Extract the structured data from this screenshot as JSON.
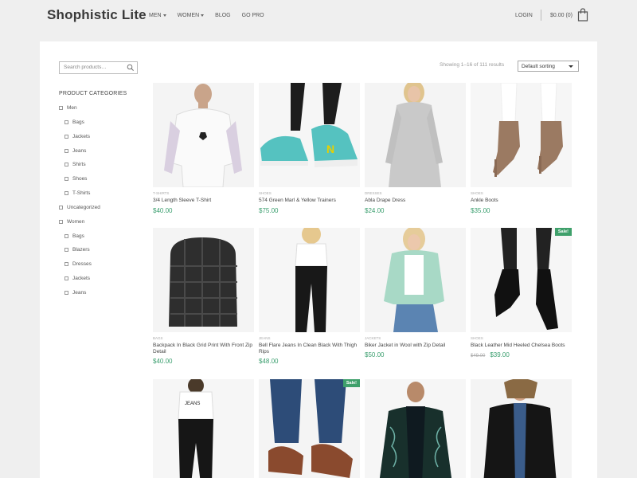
{
  "header": {
    "logo": "Shophistic Lite",
    "nav": [
      "MEN",
      "WOMEN",
      "BLOG",
      "GO PRO"
    ],
    "login": "LOGIN",
    "cart": "$0.00 (0)"
  },
  "sidebar": {
    "search_placeholder": "Search products…",
    "categories_title": "PRODUCT CATEGORIES",
    "categories": [
      "Men",
      "Bags",
      "Jackets",
      "Jeans",
      "Shirts",
      "Shoes",
      "T-Shirts",
      "Uncategorized",
      "Women",
      "Bags",
      "Blazers",
      "Dresses",
      "Jackets",
      "Jeans"
    ]
  },
  "toolbar": {
    "showing": "Showing 1–16 of 111 results",
    "sort": "Default sorting"
  },
  "products": [
    {
      "category": "T-SHIRTS",
      "name": "3/4 Length Sleeve T-Shirt",
      "price": "$40.00"
    },
    {
      "category": "SHOES",
      "name": "574 Green Marl & Yellow Trainers",
      "price": "$75.00"
    },
    {
      "category": "DRESSES",
      "name": "Abla Drape Dress",
      "price": "$24.00"
    },
    {
      "category": "SHOES",
      "name": "Ankle Boots",
      "price": "$35.00"
    },
    {
      "category": "BAGS",
      "name": "Backpack In Black Grid Print With Front Zip Detail",
      "price": "$40.00"
    },
    {
      "category": "JEANS",
      "name": "Bell Flare Jeans In Clean Black With Thigh Rips",
      "price": "$48.00"
    },
    {
      "category": "JACKETS",
      "name": "Biker Jacket in Wool with Zip Detail",
      "price": "$50.00"
    },
    {
      "category": "SHOES",
      "name": "Black Leather Mid Heeled Chelsea Boots",
      "old_price": "$49.00",
      "price": "$39.00",
      "badge": "Sale!"
    },
    {
      "badge": ""
    },
    {
      "badge": "Sale!"
    },
    {
      "badge": ""
    },
    {
      "badge": ""
    }
  ]
}
